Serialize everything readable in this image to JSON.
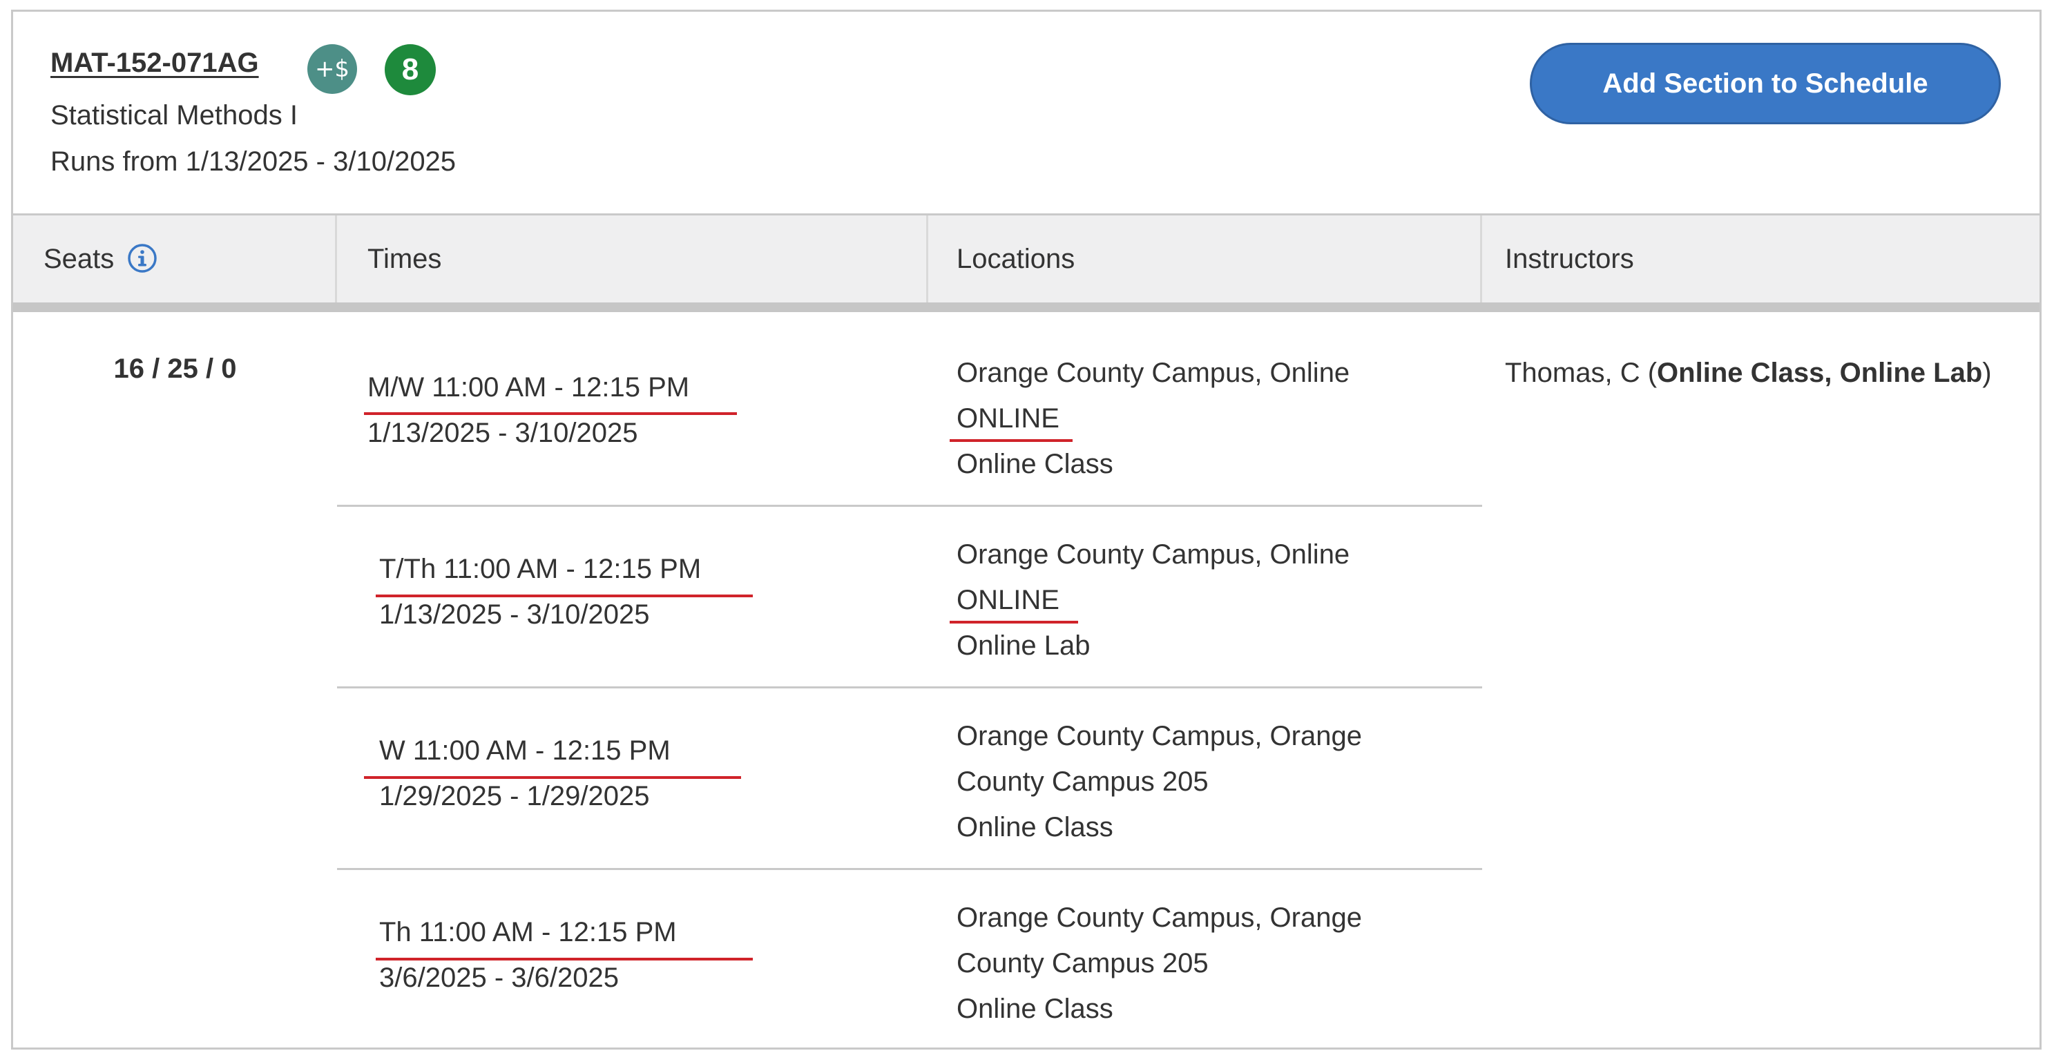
{
  "section": {
    "code": "MAT-152-071AG",
    "fee_badge": "+$",
    "count_badge": "8",
    "title": "Statistical Methods I",
    "runs": "Runs from 1/13/2025 - 3/10/2025",
    "add_button_label": "Add Section to Schedule"
  },
  "table": {
    "headers": {
      "seats": "Seats",
      "times": "Times",
      "locations": "Locations",
      "instructors": "Instructors"
    },
    "seats_value": "16 / 25 / 0",
    "meetings": [
      {
        "time": "M/W 11:00 AM - 12:15 PM",
        "dates": "1/13/2025 - 3/10/2025",
        "loc_line1": "Orange County Campus, Online",
        "loc_line2": "ONLINE",
        "loc_line3": "Online Class"
      },
      {
        "time": "T/Th 11:00 AM - 12:15 PM",
        "dates": "1/13/2025 - 3/10/2025",
        "loc_line1": "Orange County Campus, Online",
        "loc_line2": "ONLINE",
        "loc_line3": "Online Lab"
      },
      {
        "time": "W 11:00 AM - 12:15 PM",
        "dates": "1/29/2025 - 1/29/2025",
        "loc_line1": "Orange County Campus, Orange",
        "loc_line2": "County Campus 205",
        "loc_line3": "Online Class"
      },
      {
        "time": "Th 11:00 AM - 12:15 PM",
        "dates": "3/6/2025 - 3/6/2025",
        "loc_line1": "Orange County Campus, Orange",
        "loc_line2": "County Campus 205",
        "loc_line3": "Online Class"
      }
    ],
    "instructor": {
      "name": "Thomas, C (",
      "roles_bold": "Online Class, Online Lab",
      "close": ")"
    }
  },
  "colors": {
    "accent_blue": "#3a78c6",
    "fee_badge": "#4d8f87",
    "count_badge": "#1e8a3c",
    "annotation_red": "#d0232a"
  },
  "icons": {
    "seats_info": "info-circle-icon"
  }
}
